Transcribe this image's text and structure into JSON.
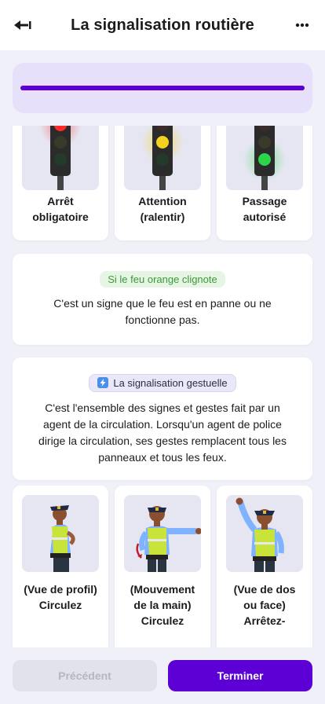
{
  "header": {
    "title": "La signalisation routière",
    "back_icon": "back-arrow-icon",
    "more_icon": "more-dots-icon"
  },
  "progress": {
    "value": 1.0,
    "color": "#5d00d6"
  },
  "traffic_lights": [
    {
      "label_line1": "Arrêt",
      "label_line2": "obligatoire",
      "active": "red"
    },
    {
      "label_line1": "Attention",
      "label_line2": "(ralentir)",
      "active": "yellow"
    },
    {
      "label_line1": "Passage",
      "label_line2": "autorisé",
      "active": "green"
    }
  ],
  "orange_info": {
    "badge": "Si le feu orange clignote",
    "text": "C'est un signe que le feu est en panne ou ne fonctionne pas."
  },
  "gestural_info": {
    "badge_icon": "lightning-icon",
    "badge": "La signalisation gestuelle",
    "text": "C'est l'ensemble des signes et gestes fait par un agent de la circulation. Lorsqu'un agent de police dirige la circulation, ses gestes remplacent tous les panneaux et tous les feux."
  },
  "gestures": [
    {
      "label": "(Vue de profil) Circulez"
    },
    {
      "label": "(Mouvement de la main) Circulez"
    },
    {
      "label": "(Vue de dos ou face) Arrêtez-"
    }
  ],
  "footer": {
    "prev_label": "Précédent",
    "next_label": "Terminer"
  },
  "colors": {
    "accent": "#5d00d6",
    "red_light": "#ff2a2a",
    "yellow_light": "#f5d21e",
    "green_light": "#2bd64a"
  }
}
